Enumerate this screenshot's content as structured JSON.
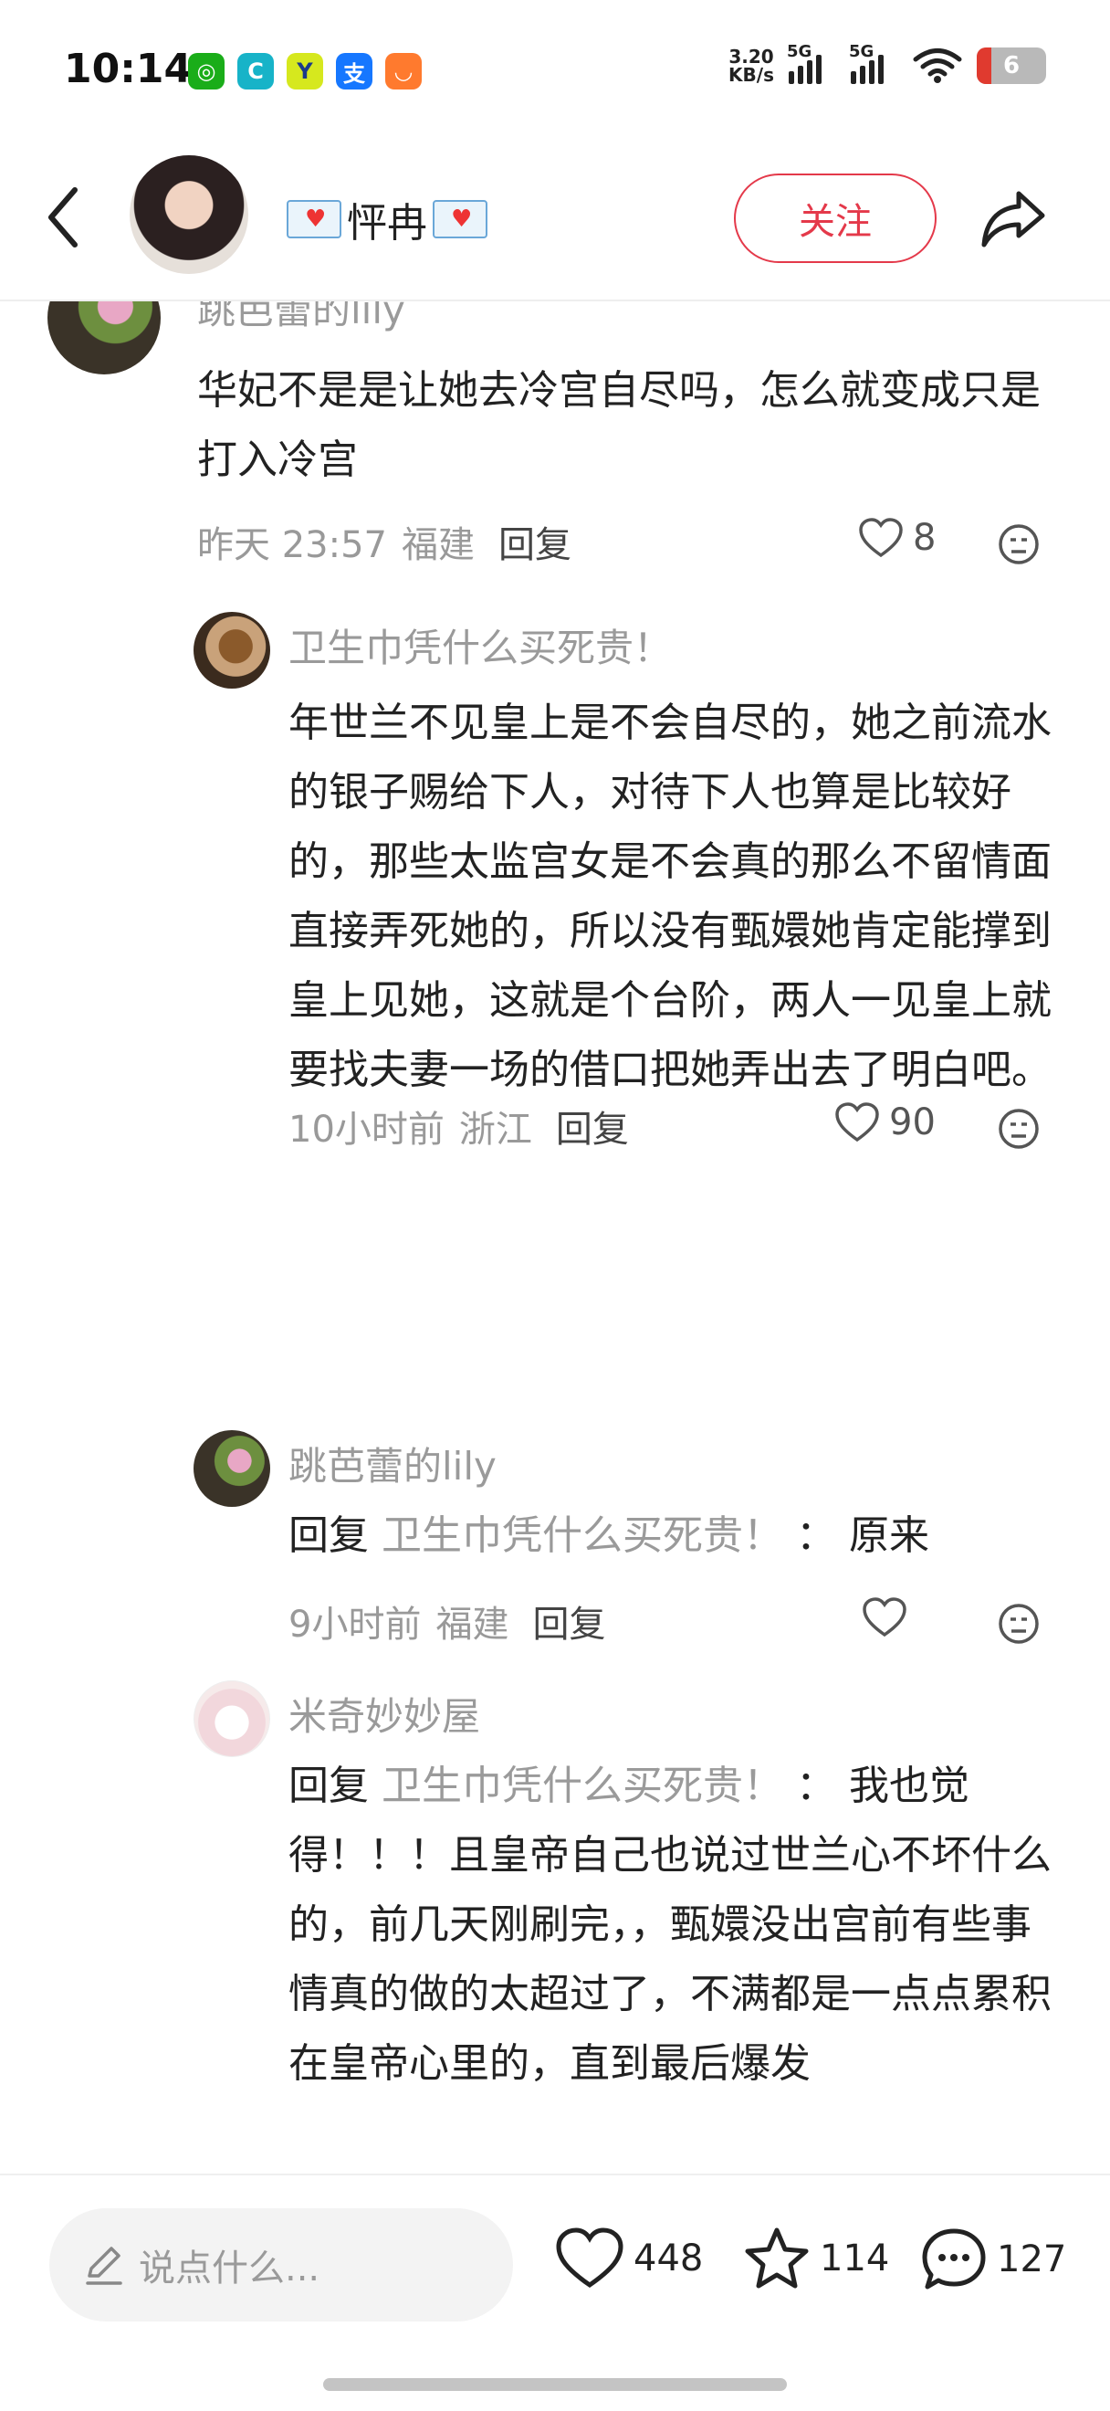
{
  "status": {
    "time": "10:14",
    "net_speed_value": "3.20",
    "net_speed_unit": "KB/s",
    "signal1": "5G",
    "signal2": "5G",
    "battery": "6",
    "app_icons": [
      "wechat-icon",
      "browser-icon",
      "feishu-icon",
      "alipay-icon",
      "fox-app-icon"
    ]
  },
  "header": {
    "username": "怦冉",
    "follow_label": "关注"
  },
  "comments": [
    {
      "name": "跳芭蕾的lily",
      "text": "华妃不是是让她去冷宫自尽吗，怎么就变成只是打入冷宫",
      "time": "昨天 23:57",
      "location": "福建",
      "reply_label": "回复",
      "likes": "8"
    },
    {
      "name": "卫生巾凭什么买死贵！",
      "text": "年世兰不见皇上是不会自尽的，她之前流水的银子赐给下人，对待下人也算是比较好的，那些太监宫女是不会真的那么不留情面直接弄死她的，所以没有甄嬛她肯定能撑到皇上见她，这就是个台阶，两人一见皇上就要找夫妻一场的借口把她弄出去了明白吧。因为不知道欢宜香的事，两个人就有再续前缘的可能，皇帝是对年世兰有真心、真情的",
      "time": "10小时前",
      "location": "浙江",
      "reply_label": "回复",
      "likes": "90"
    },
    {
      "name": "跳芭蕾的lily",
      "reply_prefix": "回复",
      "reply_target": "卫生巾凭什么买死贵！",
      "reply_sep": "：",
      "text": "原来",
      "time": "9小时前",
      "location": "福建",
      "reply_label": "回复",
      "likes": ""
    },
    {
      "name": "米奇妙妙屋",
      "reply_prefix": "回复",
      "reply_target": "卫生巾凭什么买死贵！",
      "reply_sep": "：",
      "text": "我也觉得！！！且皇帝自己也说过世兰心不坏什么的，前几天刚刷完，，甄嬛没出宫前有些事情真的做的太超过了，不满都是一点点累积在皇帝心里的，直到最后爆发"
    }
  ],
  "bottom": {
    "input_placeholder": "说点什么...",
    "likes": "448",
    "favorites": "114",
    "comments": "127"
  },
  "colors": {
    "accent": "#e4394a",
    "secondary_text": "#9a9a9a"
  }
}
